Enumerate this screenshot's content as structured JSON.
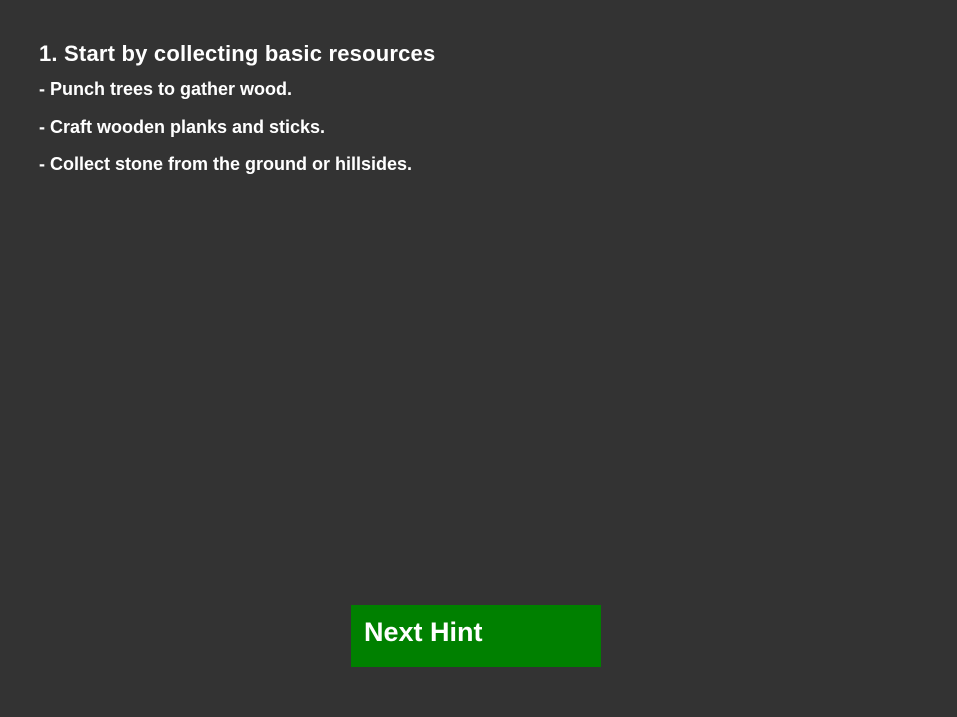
{
  "hint": {
    "title": "1. Start by collecting basic resources",
    "steps": [
      "- Punch trees to gather wood.",
      "- Craft wooden planks and sticks.",
      "- Collect stone from the ground or hillsides."
    ]
  },
  "controls": {
    "next_hint_label": "Next Hint"
  },
  "colors": {
    "background": "#333333",
    "text": "#ffffff",
    "button": "#008000"
  }
}
